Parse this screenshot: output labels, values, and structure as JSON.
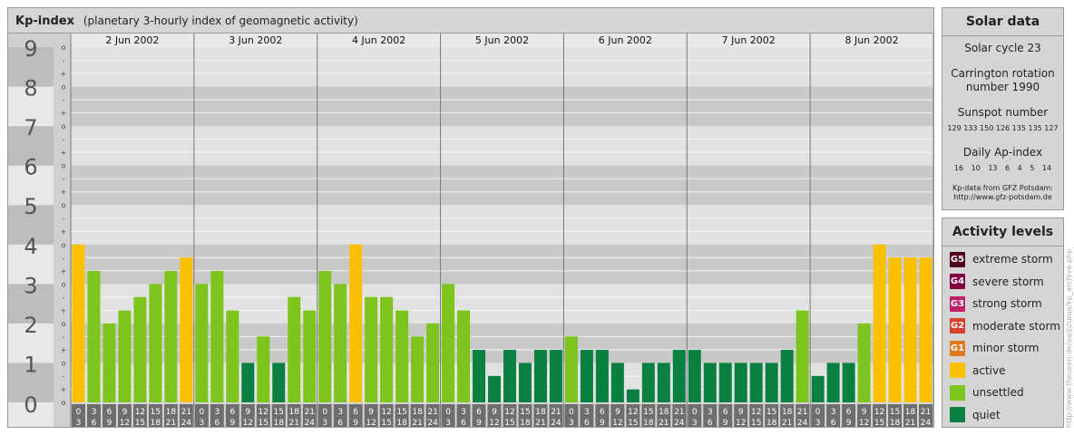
{
  "header": {
    "title": "Kp-index",
    "subtitle": "(planetary 3-hourly index of geomagnetic activity)"
  },
  "solar": {
    "title": "Solar data",
    "cycle": "Solar cycle 23",
    "carrington_1": "Carrington rotation",
    "carrington_2": "number 1990",
    "sunspot_label": "Sunspot number",
    "sunspot_values": "129 133 150 126 135 135 127",
    "ap_label": "Daily Ap-index",
    "ap_values": "16 10 13 6 4 5 14",
    "source_1": "Kp-data from GFZ Potsdam:",
    "source_2": "http://www.gfz-potsdam.de"
  },
  "activity": {
    "title": "Activity levels",
    "items": [
      {
        "code": "G5",
        "label": "extreme storm",
        "color": "#4b0020"
      },
      {
        "code": "G4",
        "label": "severe storm",
        "color": "#800040"
      },
      {
        "code": "G3",
        "label": "strong storm",
        "color": "#c0206a"
      },
      {
        "code": "G2",
        "label": "moderate storm",
        "color": "#d8402a"
      },
      {
        "code": "G1",
        "label": "minor storm",
        "color": "#e0781e"
      },
      {
        "code": "",
        "label": "active",
        "color": "#f8c000"
      },
      {
        "code": "",
        "label": "unsettled",
        "color": "#7ec41e"
      },
      {
        "code": "",
        "label": "quiet",
        "color": "#0a8040"
      }
    ]
  },
  "credit": "http://www.theusen.de/aa/pzurua/kp_archive.php",
  "chart_data": {
    "type": "bar",
    "title": "Kp-index",
    "ylim": [
      0,
      9
    ],
    "y_ticks": [
      "0",
      "1",
      "2",
      "3",
      "4",
      "5",
      "6",
      "7",
      "8",
      "9"
    ],
    "y_minor_marks": [
      "o",
      "+",
      "-"
    ],
    "days": [
      "2 Jun 2002",
      "3 Jun 2002",
      "4 Jun 2002",
      "5 Jun 2002",
      "6 Jun 2002",
      "7 Jun 2002",
      "8 Jun 2002"
    ],
    "interval_top": [
      "0",
      "3",
      "6",
      "9",
      "12",
      "15",
      "18",
      "21"
    ],
    "interval_bottom": [
      "3",
      "6",
      "9",
      "12",
      "15",
      "18",
      "21",
      "24"
    ],
    "values": [
      4.0,
      3.33,
      2.0,
      2.33,
      2.67,
      3.0,
      3.33,
      3.67,
      3.0,
      3.33,
      2.33,
      1.0,
      1.67,
      1.0,
      2.67,
      2.33,
      3.33,
      3.0,
      4.0,
      2.67,
      2.67,
      2.33,
      1.67,
      2.0,
      3.0,
      2.33,
      1.33,
      0.67,
      1.33,
      1.0,
      1.33,
      1.33,
      1.67,
      1.33,
      1.33,
      1.0,
      0.33,
      1.0,
      1.0,
      1.33,
      1.33,
      1.0,
      1.0,
      1.0,
      1.0,
      1.0,
      1.33,
      2.33,
      0.67,
      1.0,
      1.0,
      2.0,
      4.0,
      3.67,
      3.67,
      3.67
    ],
    "levels": [
      "active",
      "unsettled",
      "unsettled",
      "unsettled",
      "unsettled",
      "unsettled",
      "unsettled",
      "active",
      "unsettled",
      "unsettled",
      "unsettled",
      "quiet",
      "unsettled",
      "quiet",
      "unsettled",
      "unsettled",
      "unsettled",
      "unsettled",
      "active",
      "unsettled",
      "unsettled",
      "unsettled",
      "unsettled",
      "unsettled",
      "unsettled",
      "unsettled",
      "quiet",
      "quiet",
      "quiet",
      "quiet",
      "quiet",
      "quiet",
      "unsettled",
      "quiet",
      "quiet",
      "quiet",
      "quiet",
      "quiet",
      "quiet",
      "quiet",
      "quiet",
      "quiet",
      "quiet",
      "quiet",
      "quiet",
      "quiet",
      "quiet",
      "unsettled",
      "quiet",
      "quiet",
      "quiet",
      "unsettled",
      "active",
      "active",
      "active",
      "active"
    ],
    "colors": {
      "quiet": "#0a8040",
      "unsettled": "#7ec41e",
      "active": "#f8c000"
    },
    "grid": true
  }
}
